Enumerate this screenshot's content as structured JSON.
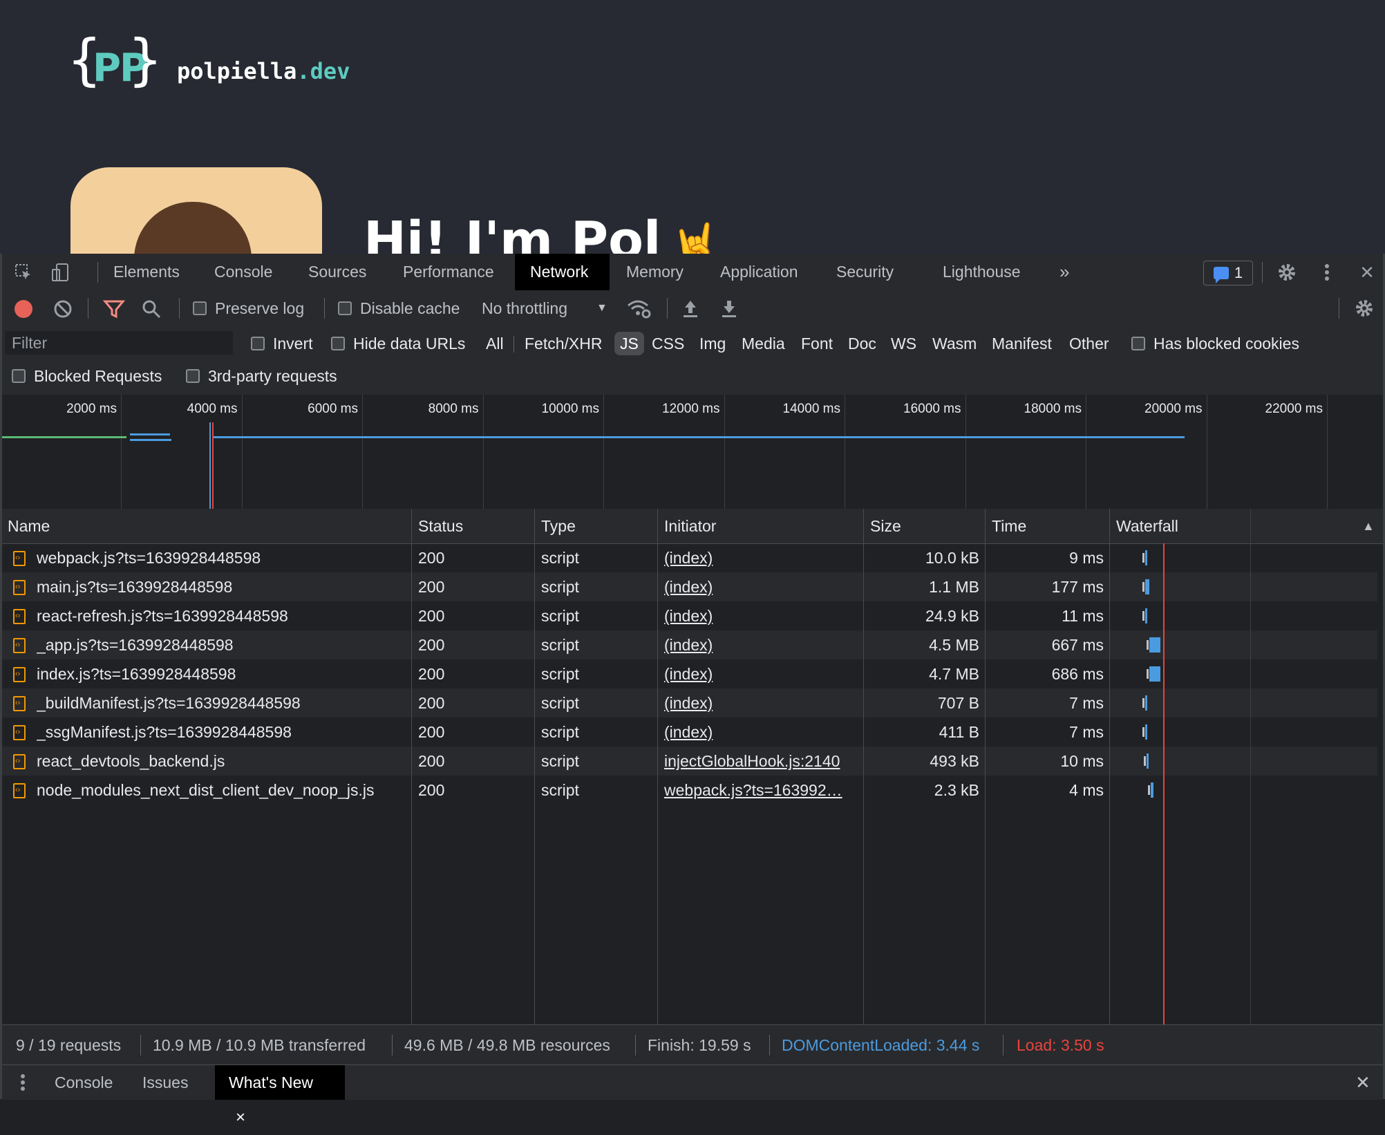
{
  "page": {
    "brace_left": "{",
    "brace_right": "}",
    "logo_initials": "PP",
    "site_name": "polpiella",
    "site_tld": ".dev",
    "hero_text": "Hi! I'm Pol",
    "hero_emoji": "🤘"
  },
  "devtools": {
    "tabs": [
      "Elements",
      "Console",
      "Sources",
      "Performance",
      "Network",
      "Memory",
      "Application",
      "Security",
      "Lighthouse"
    ],
    "active_tab": "Network",
    "more_tabs": "»",
    "issues_count": "1",
    "toolbar": {
      "preserve_log": "Preserve log",
      "disable_cache": "Disable cache",
      "throttling": "No throttling",
      "dropdown_arrow": "▼"
    },
    "filter": {
      "placeholder": "Filter",
      "invert": "Invert",
      "hide_data_urls": "Hide data URLs",
      "types": [
        "All",
        "Fetch/XHR",
        "JS",
        "CSS",
        "Img",
        "Media",
        "Font",
        "Doc",
        "WS",
        "Wasm",
        "Manifest",
        "Other"
      ],
      "active_type": "JS",
      "has_blocked_cookies": "Has blocked cookies",
      "blocked_requests": "Blocked Requests",
      "third_party": "3rd-party requests"
    },
    "overview": {
      "ticks": [
        "2000 ms",
        "4000 ms",
        "6000 ms",
        "8000 ms",
        "10000 ms",
        "12000 ms",
        "14000 ms",
        "16000 ms",
        "18000 ms",
        "20000 ms",
        "22000 ms"
      ],
      "colors": {
        "dom": "#4b9be0",
        "load": "#e8453c",
        "doc": "#5bb974",
        "script": "#4b9be0"
      }
    },
    "columns": [
      "Name",
      "Status",
      "Type",
      "Initiator",
      "Size",
      "Time",
      "Waterfall"
    ],
    "sort_indicator": "▲",
    "rows": [
      {
        "name": "webpack.js?ts=1639928448598",
        "status": "200",
        "type": "script",
        "initiator": "(index)",
        "size": "10.0 kB",
        "time": "9 ms"
      },
      {
        "name": "main.js?ts=1639928448598",
        "status": "200",
        "type": "script",
        "initiator": "(index)",
        "size": "1.1 MB",
        "time": "177 ms"
      },
      {
        "name": "react-refresh.js?ts=1639928448598",
        "status": "200",
        "type": "script",
        "initiator": "(index)",
        "size": "24.9 kB",
        "time": "11 ms"
      },
      {
        "name": "_app.js?ts=1639928448598",
        "status": "200",
        "type": "script",
        "initiator": "(index)",
        "size": "4.5 MB",
        "time": "667 ms"
      },
      {
        "name": "index.js?ts=1639928448598",
        "status": "200",
        "type": "script",
        "initiator": "(index)",
        "size": "4.7 MB",
        "time": "686 ms"
      },
      {
        "name": "_buildManifest.js?ts=1639928448598",
        "status": "200",
        "type": "script",
        "initiator": "(index)",
        "size": "707 B",
        "time": "7 ms"
      },
      {
        "name": "_ssgManifest.js?ts=1639928448598",
        "status": "200",
        "type": "script",
        "initiator": "(index)",
        "size": "411 B",
        "time": "7 ms"
      },
      {
        "name": "react_devtools_backend.js",
        "status": "200",
        "type": "script",
        "initiator": "injectGlobalHook.js:2140",
        "size": "493 kB",
        "time": "10 ms"
      },
      {
        "name": "node_modules_next_dist_client_dev_noop_js.js",
        "status": "200",
        "type": "script",
        "initiator": "webpack.js?ts=163992…",
        "size": "2.3 kB",
        "time": "4 ms"
      }
    ],
    "status": {
      "requests": "9 / 19 requests",
      "transferred": "10.9 MB / 10.9 MB transferred",
      "resources": "49.6 MB / 49.8 MB resources",
      "finish": "Finish: 19.59 s",
      "dom_content_loaded": "DOMContentLoaded: 3.44 s",
      "load": "Load: 3.50 s",
      "dom_color": "#4b9be0",
      "load_color": "#e8453c"
    },
    "drawer": {
      "tabs": [
        "Console",
        "Issues",
        "What's New"
      ],
      "active_tab": "What's New",
      "close": "×"
    },
    "close": "✕"
  }
}
